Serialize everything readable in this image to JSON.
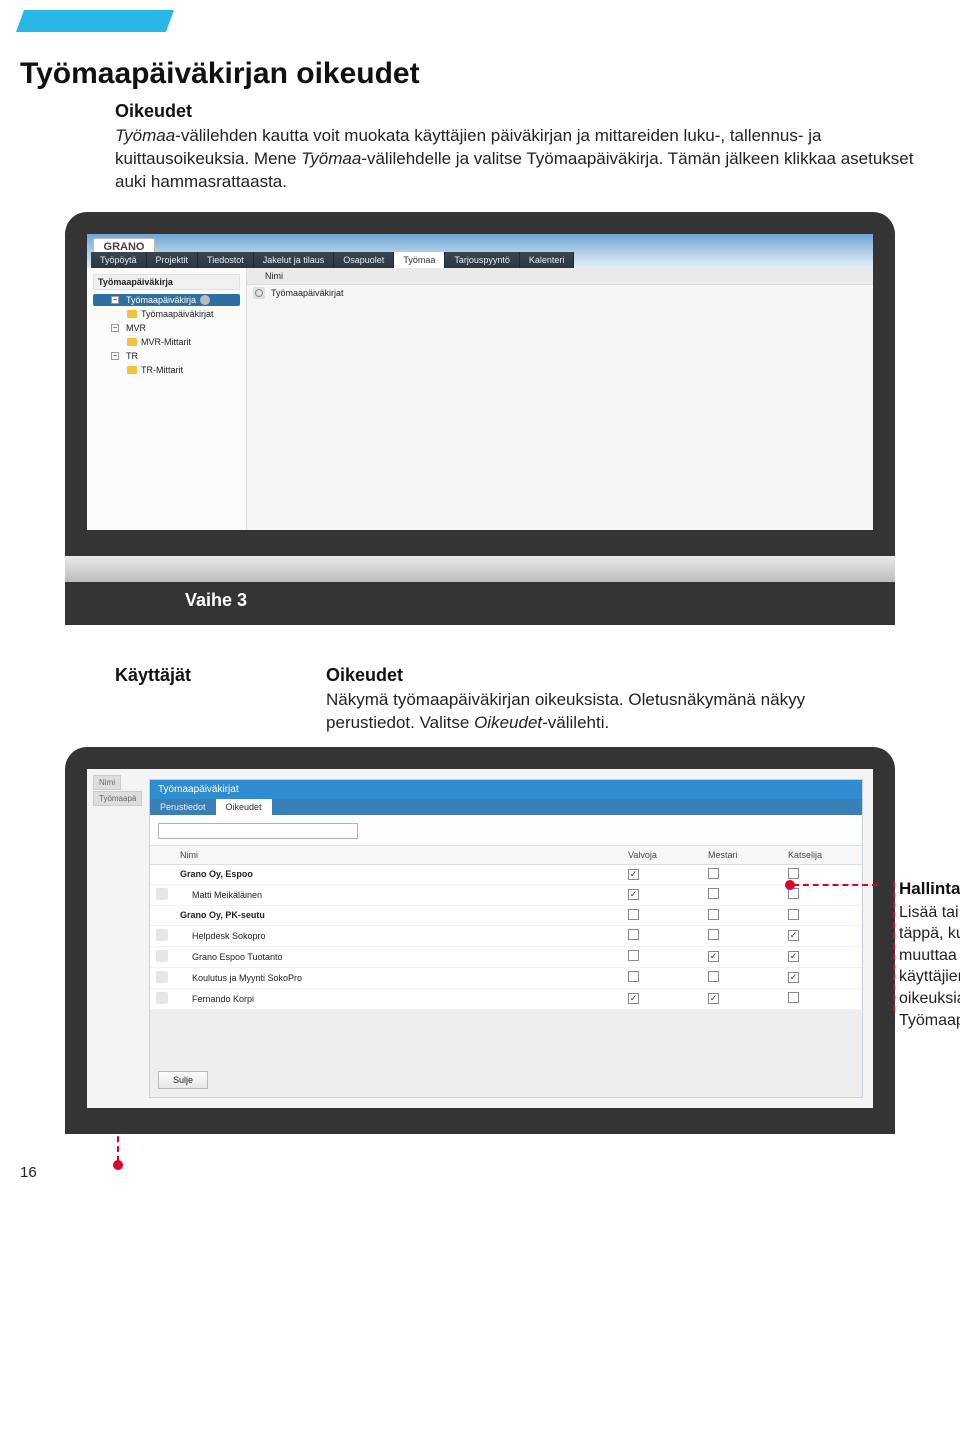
{
  "page_number": "16",
  "accent": "#29b7e6",
  "title": "Työmaapäiväkirjan oikeudet",
  "lead": {
    "heading": "Oikeudet",
    "body_prefix": "Työmaa",
    "body_rest": "-välilehden kautta voit muokata käyttäjien päiväkirjan ja mittareiden luku-, tallennus- ja kuittausoikeuksia. Mene ",
    "body_em2": "Työmaa",
    "body_rest2": "-välilehdelle ja valitse Työmaapäiväkirja. Tämän jälkeen klikkaa asetukset auki hammasrattaasta."
  },
  "stage_label": "Vaihe 3",
  "screenshot1": {
    "logo": "GRANO",
    "tabs": [
      "Työpöytä",
      "Projektit",
      "Tiedostot",
      "Jakelut ja tilaus",
      "Osapuolet",
      "Työmaa",
      "Tarjouspyyntö",
      "Kalenteri"
    ],
    "selected_tab": "Työmaa",
    "tree_header": "Työmaapäiväkirja",
    "tree": [
      {
        "label": "Työmaapäiväkirja",
        "selected": true
      },
      {
        "label": "Työmaapäiväkirjat"
      },
      {
        "label": "MVR"
      },
      {
        "label": "MVR-Mittarit"
      },
      {
        "label": "TR"
      },
      {
        "label": "TR-Mittarit"
      }
    ],
    "list_header": "Nimi",
    "list_row": "Työmaapäiväkirjat"
  },
  "mid": {
    "left_heading": "Käyttäjät",
    "right_heading": "Oikeudet",
    "right_body_a": "Näkymä työmaapäiväkirjan oikeuksista. Oletusnäkymänä näkyy perustiedot. Valitse ",
    "right_body_em": "Oikeudet",
    "right_body_b": "-välilehti."
  },
  "screenshot2": {
    "panel_title": "Työmaapäiväkirjat",
    "behind_tabs": [
      "Nimi",
      "Työmaapä"
    ],
    "subtabs": [
      "Perustiedot",
      "Oikeudet"
    ],
    "selected_subtab": "Oikeudet",
    "columns": [
      "Nimi",
      "Valvoja",
      "Mestari",
      "Katselija"
    ],
    "rows": [
      {
        "name": "Grano Oy, Espoo",
        "group": true,
        "valvoja": true,
        "mestari": false,
        "katselija": false
      },
      {
        "name": "Matti Meikäläinen",
        "valvoja": true,
        "mestari": false,
        "katselija": false
      },
      {
        "name": "Grano Oy, PK-seutu",
        "group": true,
        "valvoja": false,
        "mestari": false,
        "katselija": false
      },
      {
        "name": "Helpdesk Sokopro",
        "valvoja": false,
        "mestari": false,
        "katselija": true
      },
      {
        "name": "Grano Espoo Tuotanto",
        "valvoja": false,
        "mestari": true,
        "katselija": true
      },
      {
        "name": "Koulutus ja Myynti SokoPro",
        "valvoja": false,
        "mestari": false,
        "katselija": true
      },
      {
        "name": "Fernando Korpi",
        "valvoja": true,
        "mestari": true,
        "katselija": false
      }
    ],
    "close_btn": "Sulje"
  },
  "callout": {
    "heading": "Hallinta",
    "body": "Lisää tai poista täppä, kun haluat muuttaa projektin käyttäjien oikeuksia koskien Työmaapäiväkirjaa."
  }
}
